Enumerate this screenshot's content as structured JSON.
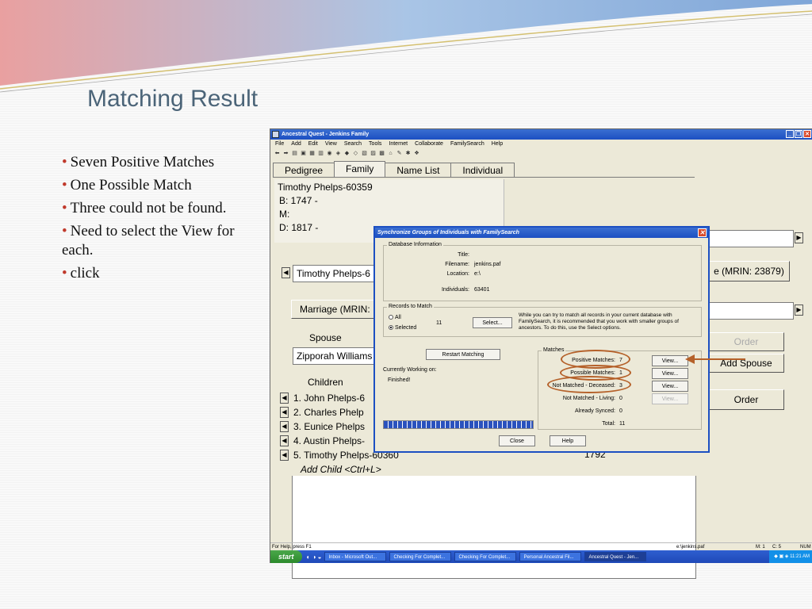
{
  "slide": {
    "title": "Matching Result",
    "bullets": [
      "Seven Positive Matches",
      "One Possible Match",
      "Three could not be found.",
      "Need to select the View for each.",
      "click"
    ]
  },
  "window": {
    "title": "Ancestral Quest - Jenkins Family",
    "menu": [
      "File",
      "Add",
      "Edit",
      "View",
      "Search",
      "Tools",
      "Internet",
      "Collaborate",
      "FamilySearch",
      "Help"
    ],
    "tabs": [
      "Pedigree",
      "Family",
      "Name List",
      "Individual"
    ],
    "active_tab": "Family",
    "family": {
      "head_name": "Timothy Phelps-60359",
      "birth": "B: 1747 -",
      "marriage": "M:",
      "death": "D: 1817 -",
      "husband_combo": "Timothy Phelps-6",
      "marriage_button": "Marriage (MRIN:",
      "mrin_button": "e (MRIN: 23879)",
      "spouse_label": "Spouse",
      "spouse_combo": "Zipporah Williams",
      "order_button_1": "Order",
      "add_spouse_button": "Add Spouse",
      "order_button_2": "Order",
      "children_label": "Children",
      "children": [
        "1.  John Phelps-6",
        "2.  Charles Phelp",
        "3.  Eunice Phelps",
        "4.  Austin Phelps-",
        "5.  Timothy Phelps-60360"
      ],
      "child5_year": "1792",
      "add_child": "Add Child <Ctrl+L>"
    },
    "status": {
      "help": "For Help, press F1",
      "path": "e:\\jenkins.paf",
      "pos_m": "M: 1",
      "pos_c": "C: 5",
      "num": "NUM"
    },
    "taskbar": {
      "start": "start",
      "items": [
        "Inbox - Microsoft Out...",
        "Checking For Complet...",
        "Checking For Complet...",
        "Personal Ancestral Fil...",
        "Ancestral Quest - Jen..."
      ],
      "clock": "11:21 AM"
    }
  },
  "dialog": {
    "title": "Synchronize Groups of Individuals with FamilySearch",
    "db_group": "Database Information",
    "title_label": "Title:",
    "filename_label": "Filename:",
    "filename": "jenkins.paf",
    "location_label": "Location:",
    "location": "e:\\",
    "individuals_label": "Individuals:",
    "individuals": "63401",
    "records_group": "Records to Match",
    "opt_all": "All",
    "opt_selected": "Selected",
    "selected_count": "11",
    "select_button": "Select...",
    "advice": "While you can try to match all records in your current database with FamilySearch, it is recommended that you work with smaller groups of ancestors. To do this, use the Select options.",
    "restart_button": "Restart Matching",
    "working_label": "Currently Working on:",
    "working_value": "Finished!",
    "matches_group": "Matches",
    "positive_label": "Positive Matches:",
    "positive": "7",
    "possible_label": "Possible Matches:",
    "possible": "1",
    "nm_deceased_label": "Not Matched - Deceased:",
    "nm_deceased": "3",
    "nm_living_label": "Not Matched - Living:",
    "nm_living": "0",
    "synced_label": "Already Synced:",
    "synced": "0",
    "total_label": "Total:",
    "total": "11",
    "view": "View...",
    "close_button": "Close",
    "help_button": "Help"
  },
  "colors": {
    "annotation": "#b5612a",
    "titlebar": "#1c4fc2"
  }
}
